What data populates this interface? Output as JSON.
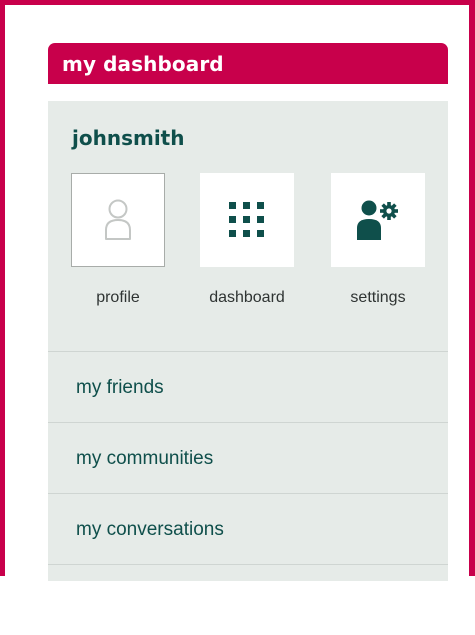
{
  "colors": {
    "brand": "#c8004b",
    "panel_bg": "#e6ebe8",
    "teal": "#0f4f4b",
    "label_gray": "#2f3433"
  },
  "header": {
    "title": "my dashboard"
  },
  "user": {
    "name": "johnsmith"
  },
  "tiles": [
    {
      "label": "profile",
      "icon": "user-outline-icon"
    },
    {
      "label": "dashboard",
      "icon": "grid-icon"
    },
    {
      "label": "settings",
      "icon": "user-gear-icon"
    }
  ],
  "menu": {
    "items": [
      {
        "label": "my friends"
      },
      {
        "label": "my communities"
      },
      {
        "label": "my conversations"
      }
    ]
  }
}
